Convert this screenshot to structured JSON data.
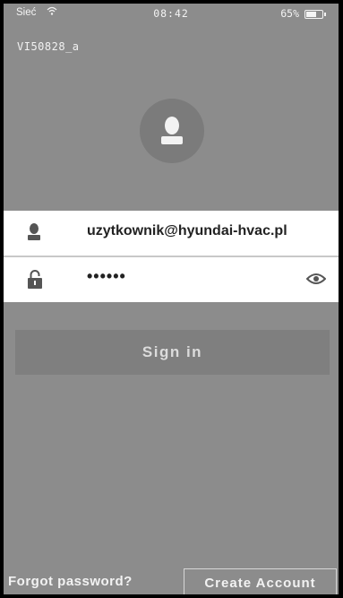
{
  "status_bar": {
    "carrier": "Sieć",
    "time": "08:42",
    "battery_percent": "65%",
    "battery_level": 0.65,
    "wifi_icon": "wifi-icon",
    "battery_icon": "battery-icon"
  },
  "device_name": "VI50828_a",
  "avatar_icon": "user-avatar-icon",
  "login_form": {
    "username_icon": "user-icon",
    "username_value": "uzytkownik@hyundai-hvac.pl",
    "password_icon": "lock-icon",
    "password_value": "••••••",
    "show_password_icon": "eye-icon"
  },
  "signin_label": "Sign in",
  "forgot_password_label": "Forgot password?",
  "create_account_label": "Create Account",
  "colors": {
    "background": "#8c8c8c",
    "field_background": "#ffffff",
    "button_background": "#7f7f7f",
    "text_light": "#f2f2f2"
  }
}
